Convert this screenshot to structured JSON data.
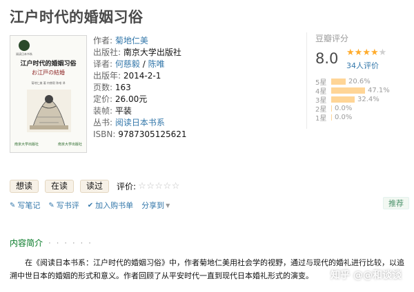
{
  "book": {
    "title": "江户时代的婚姻习俗"
  },
  "cover": {
    "series_badge": "阅读日本书系",
    "title": "江户时代的婚姻习俗",
    "subtitle": "お江戸の結婚",
    "authors": "菊地仁美 著  何慈毅 陈唯 译",
    "publisher_left": "南京大学出版社",
    "publisher_right": "南京大学出版社"
  },
  "info": {
    "author_label": "作者:",
    "author": "菊地仁美",
    "publisher_label": "出版社:",
    "publisher": "南京大学出版社",
    "translator_label": "译者:",
    "translator_1": "何慈毅",
    "translator_sep": " / ",
    "translator_2": "陈唯",
    "pubdate_label": "出版年:",
    "pubdate": "2014-2-1",
    "pages_label": "页数:",
    "pages": "163",
    "price_label": "定价:",
    "price": "26.00元",
    "binding_label": "装帧:",
    "binding": "平装",
    "series_label": "丛书:",
    "series": "阅读日本书系",
    "isbn_label": "ISBN:",
    "isbn": "9787305125621"
  },
  "rating": {
    "header": "豆瓣评分",
    "score": "8.0",
    "stars_filled": 4,
    "count": "34人评价",
    "bar_color": "#ffd596",
    "distribution": [
      {
        "label": "5星",
        "pct": 20.6,
        "text": "20.6%"
      },
      {
        "label": "4星",
        "pct": 47.1,
        "text": "47.1%"
      },
      {
        "label": "3星",
        "pct": 32.4,
        "text": "32.4%"
      },
      {
        "label": "2星",
        "pct": 0.0,
        "text": "0.0%"
      },
      {
        "label": "1星",
        "pct": 0.0,
        "text": "0.0%"
      }
    ]
  },
  "actions": {
    "want": "想读",
    "reading": "在读",
    "read": "读过",
    "rate_label": "评价:",
    "rate_stars": "☆☆☆☆☆"
  },
  "ops": {
    "write_note": "写笔记",
    "write_review": "写书评",
    "add_cart": "加入购书单",
    "share": "分享到",
    "recommend": "推荐"
  },
  "section": {
    "intro_title": "内容简介",
    "dots": "· · · · · ·",
    "intro_text": "在《阅读日本书系：江户时代的婚姻习俗》中，作者菊地仁美用社会学的视野，通过与现代的婚礼进行比较，以追溯中世日本的婚姻的形式和意义。作者回顾了从平安时代一直到现代日本婚礼形式的演变。"
  },
  "watermark": {
    "text": "知乎 @@和谈谈"
  }
}
